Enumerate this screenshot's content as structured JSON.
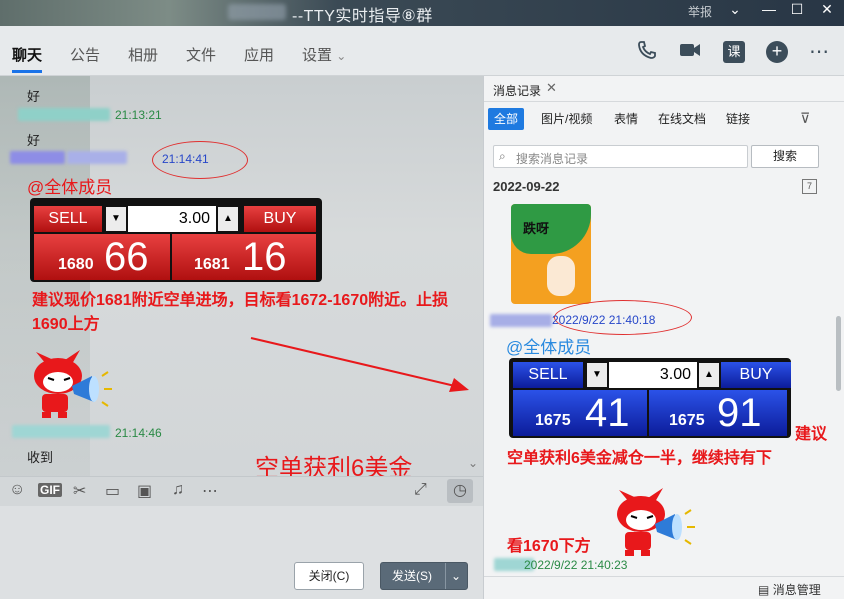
{
  "titlebar": {
    "title": "--TTY实时指导⑧群",
    "report": "举报"
  },
  "tabs": [
    "聊天",
    "公告",
    "相册",
    "文件",
    "应用",
    "设置"
  ],
  "header_icons": [
    "phone-icon",
    "video-icon",
    "lesson-icon",
    "add-icon",
    "more-icon"
  ],
  "chat": {
    "msg1": "好",
    "time1": "21:13:21",
    "msg2": "好",
    "time2": "21:14:41",
    "mention": "@全体成员",
    "panel": {
      "sell": "SELL",
      "buy": "BUY",
      "qty": "3.00",
      "sell_small": "1680",
      "sell_big": "66",
      "buy_small": "1681",
      "buy_big": "16"
    },
    "advice": "建议现价1681附近空单进场，目标看1672-1670附近。止损1690上方",
    "time3": "21:14:46",
    "msg3": "收到",
    "annotation": "空单获利6美金"
  },
  "input": {
    "close_label": "关闭(C)",
    "send_label": "发送(S)"
  },
  "history": {
    "tab_label": "消息记录",
    "filters": [
      "全部",
      "图片/视频",
      "表情",
      "在线文档",
      "链接"
    ],
    "search_placeholder": "搜索消息记录",
    "search_button": "搜索",
    "date": "2022-09-22",
    "sticker_text": "跌呀",
    "time1": "2022/9/22 21:40:18",
    "mention": "@全体成员",
    "panel": {
      "sell": "SELL",
      "buy": "BUY",
      "qty": "3.00",
      "sell_small": "1675",
      "sell_big": "41",
      "buy_small": "1675",
      "buy_big": "91"
    },
    "advice_1": "建议",
    "advice_2": "空单获利6美金减仓一半，继续持有下",
    "advice_3": "看1670下方",
    "time2": "2022/9/22 21:40:23",
    "manage_label": "消息管理"
  },
  "colors": {
    "accent": "#1f7ae0",
    "red": "#e8181b",
    "green_time": "#2a8a45"
  }
}
